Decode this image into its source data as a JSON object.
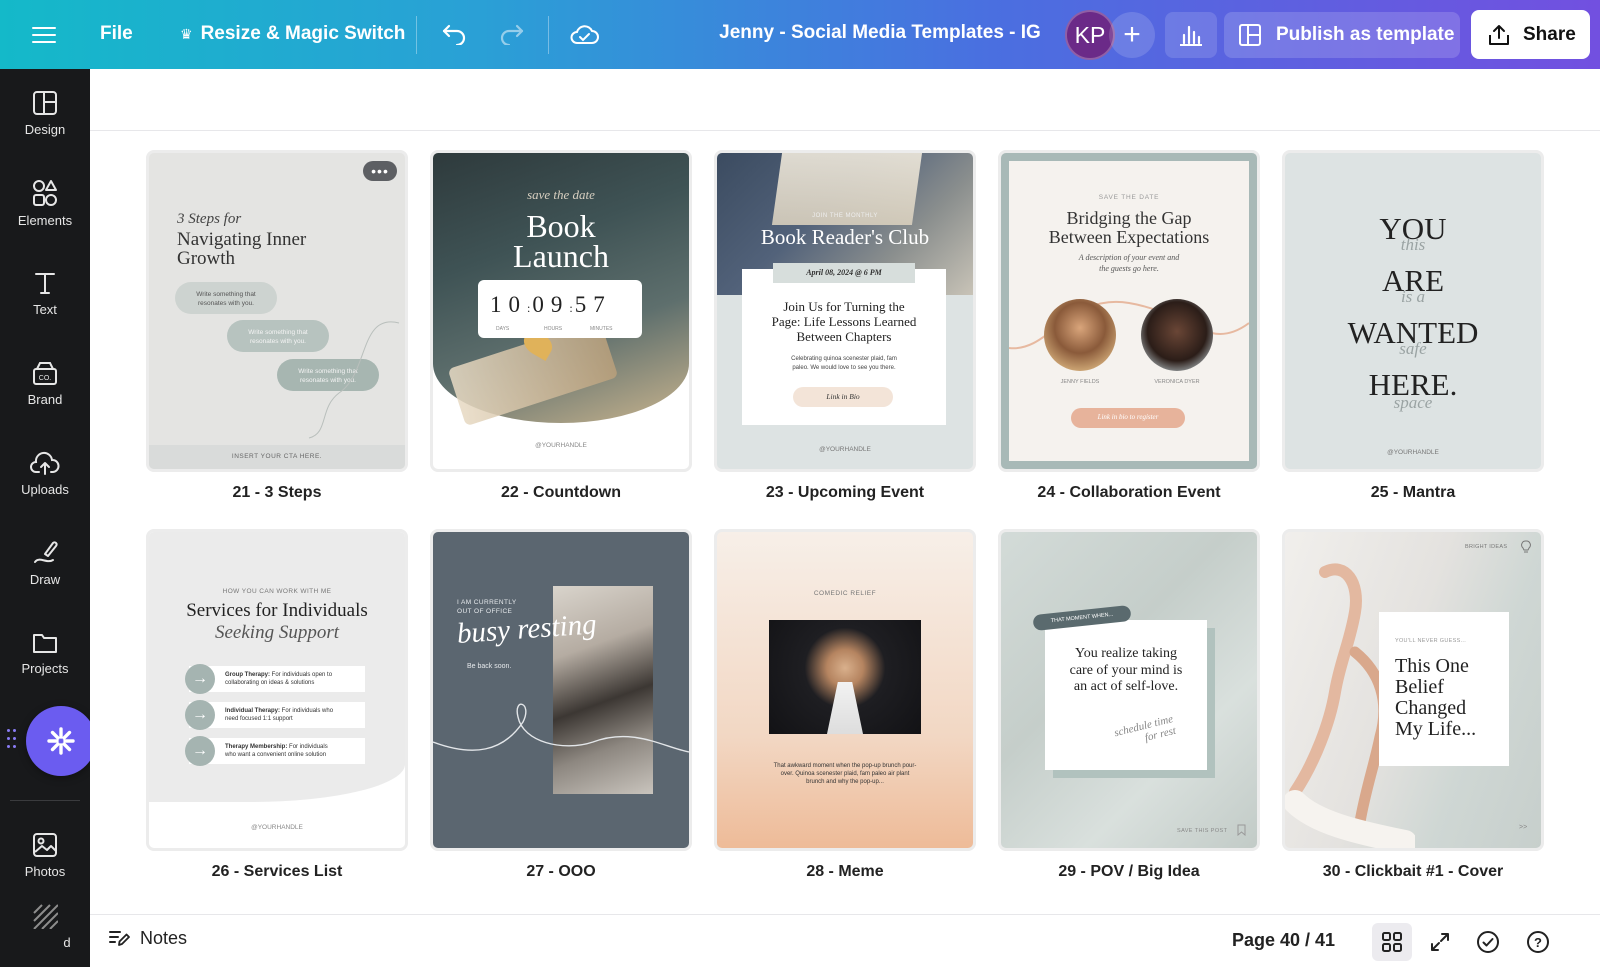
{
  "topbar": {
    "file_label": "File",
    "resize_label": "Resize & Magic Switch",
    "document_title": "Jenny - Social Media Templates - IG",
    "avatar_initials": "KP",
    "add_label": "+",
    "publish_label": "Publish as template",
    "share_label": "Share"
  },
  "sidebar": {
    "items": [
      {
        "label": "Design",
        "icon": "design-icon"
      },
      {
        "label": "Elements",
        "icon": "elements-icon"
      },
      {
        "label": "Text",
        "icon": "text-icon"
      },
      {
        "label": "Brand",
        "icon": "brand-icon"
      },
      {
        "label": "Uploads",
        "icon": "uploads-icon"
      },
      {
        "label": "Draw",
        "icon": "draw-icon"
      },
      {
        "label": "Projects",
        "icon": "projects-icon"
      },
      {
        "label": "Photos",
        "icon": "photos-icon"
      },
      {
        "label": "d",
        "icon": "background-icon"
      }
    ]
  },
  "pages": [
    {
      "label": "21 - 3 Steps"
    },
    {
      "label": "22 - Countdown"
    },
    {
      "label": "23 - Upcoming Event"
    },
    {
      "label": "24 - Collaboration Event"
    },
    {
      "label": "25 - Mantra"
    },
    {
      "label": "26 - Services List"
    },
    {
      "label": "27 - OOO"
    },
    {
      "label": "28 - Meme"
    },
    {
      "label": "29 - POV / Big Idea"
    },
    {
      "label": "30 - Clickbait #1 - Cover"
    }
  ],
  "thumbs": {
    "t21": {
      "pre": "3 Steps for",
      "title1": "Navigating Inner",
      "title2": "Growth",
      "b1a": "Write something that",
      "b1b": "resonates with you.",
      "b2a": "Write something that",
      "b2b": "resonates with you.",
      "b3a": "Write something that",
      "b3b": "resonates with you.",
      "cta": "INSERT YOUR CTA HERE."
    },
    "t22": {
      "script": "save the date",
      "title1": "Book",
      "title2": "Launch",
      "d1": "1",
      "d2": "0",
      "h1": "0",
      "h2": "9",
      "m1": "5",
      "m2": "7",
      "days": "DAYS",
      "hours": "HOURS",
      "minutes": "MINUTES",
      "handle": "@YOURHANDLE"
    },
    "t23": {
      "pre": "JOIN THE MONTHLY",
      "title": "Book Reader's Club",
      "date": "April 08, 2024 @ 6 PM",
      "body1": "Join Us for Turning the",
      "body2": "Page: Life Lessons Learned",
      "body3": "Between Chapters",
      "small1": "Celebrating quinoa scenester plaid, fam",
      "small2": "paleo. We would love to see you there.",
      "link": "Link in Bio",
      "handle": "@YOURHANDLE"
    },
    "t24": {
      "pre": "SAVE THE DATE",
      "title1": "Bridging the Gap",
      "title2": "Between Expectations",
      "desc1": "A description of your event and",
      "desc2": "the guests go here.",
      "name1": "JENNY FIELDS",
      "name2": "VERONICA DYER",
      "cta": "Link in bio to register"
    },
    "t25": {
      "l1": "YOU",
      "s1": "this",
      "l2": "ARE",
      "s2": "is a",
      "l3": "WANTED",
      "s3": "safe",
      "l4": "HERE.",
      "s4": "space",
      "handle": "@YOURHANDLE"
    },
    "t26": {
      "pre": "HOW YOU CAN WORK WITH ME",
      "title1": "Services for Individuals",
      "title2": "Seeking Support",
      "i1b": "Group Therapy:",
      "i1a": " For individuals open to",
      "i1c": "collaborating on ideas & solutions",
      "i2b": "Individual Therapy:",
      "i2a": " For individuals who",
      "i2c": "need focused 1:1 support",
      "i3b": "Therapy Membership:",
      "i3a": " For individuals",
      "i3c": "who want a convenient online solution",
      "handle": "@YOURHANDLE"
    },
    "t27": {
      "pre1": "I AM CURRENTLY",
      "pre2": "OUT OF OFFICE",
      "script": "busy resting",
      "back": "Be back soon."
    },
    "t28": {
      "pre": "COMEDIC RELIEF",
      "c1": "That awkward moment when the pop-up brunch pour-",
      "c2": "over. Quinoa scenester plaid, fam paleo air plant",
      "c3": "brunch and why the pop-up..."
    },
    "t29": {
      "tag": "THAT MOMENT WHEN...",
      "q1": "You realize taking",
      "q2": "care of your mind is",
      "q3": "an act of self-love.",
      "script1": "schedule time",
      "script2": "for rest",
      "save": "SAVE THIS POST"
    },
    "t30": {
      "top": "BRIGHT IDEAS",
      "pre": "YOU'LL NEVER GUESS...",
      "t1": "This One",
      "t2": "Belief",
      "t3": "Changed",
      "t4": "My Life...",
      "arrow": ">>"
    }
  },
  "bottombar": {
    "notes_label": "Notes",
    "page_indicator": "Page 40 / 41"
  }
}
